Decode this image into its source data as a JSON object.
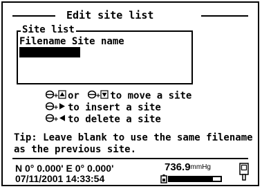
{
  "window": {
    "title": "Edit site list"
  },
  "site_list": {
    "label": "Site list",
    "columns": "Filename Site name",
    "selected_row_empty": ""
  },
  "hints": [
    {
      "text": "or",
      "tail": "to move a site"
    },
    {
      "text": "to insert a site"
    },
    {
      "text": "to delete a site"
    }
  ],
  "tip": "Tip: Leave blank to use the same filename as the previous site.",
  "status": {
    "coordinates": "N 0° 0.000' E 0° 0.000'",
    "datetime": "07/11/2001 14:33:54",
    "pressure_value": "736.9",
    "pressure_unit": "mmHg",
    "battery_level_fraction": 0.85
  }
}
